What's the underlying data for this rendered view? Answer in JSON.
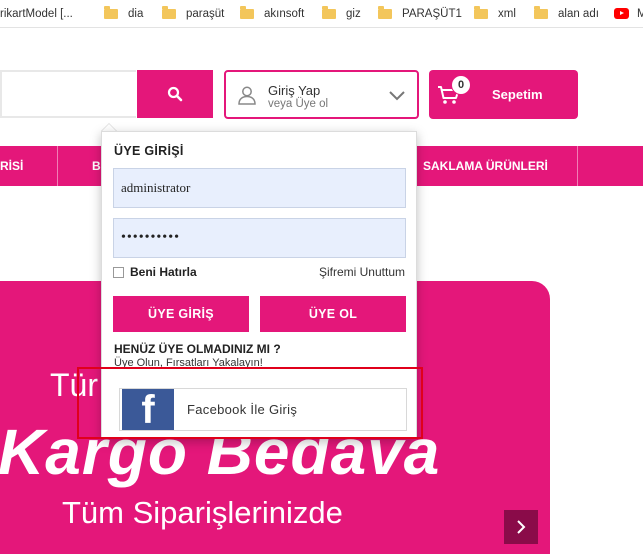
{
  "bookmarks": [
    {
      "label": "rikartModel [...",
      "icon": "none"
    },
    {
      "label": "dia",
      "icon": "folder-icon"
    },
    {
      "label": "paraşüt",
      "icon": "folder-icon"
    },
    {
      "label": "akınsoft",
      "icon": "folder-icon"
    },
    {
      "label": "giz",
      "icon": "folder-icon"
    },
    {
      "label": "PARAŞÜT1",
      "icon": "folder-icon"
    },
    {
      "label": "xml",
      "icon": "folder-icon"
    },
    {
      "label": "alan adı",
      "icon": "folder-icon"
    },
    {
      "label": "M",
      "icon": "youtube-icon"
    }
  ],
  "header": {
    "search_icon": "search-icon",
    "login_title": "Giriş Yap",
    "login_sub": "veya Üye ol",
    "cart_label": "Sepetim",
    "cart_count": "0"
  },
  "nav": {
    "items": [
      "RİSİ",
      "BI",
      "SAKLAMA ÜRÜNLERİ"
    ]
  },
  "hero": {
    "line1": "Tür",
    "line2": "Kargo Bedava",
    "line3": "Tüm Siparişlerinizde"
  },
  "login_panel": {
    "title": "ÜYE GİRİŞİ",
    "username_value": "administrator",
    "password_value": "••••••••••",
    "remember_label": "Beni Hatırla",
    "forgot_label": "Şifremi Unuttum",
    "login_button": "ÜYE GİRİŞ",
    "register_button": "ÜYE OL",
    "question_title": "HENÜZ ÜYE OLMADINIZ MI ?",
    "question_sub": "Üye Olun, Fırsatları Yakalayın!",
    "facebook_button": "Facebook İle Giriş"
  },
  "colors": {
    "brand": "#e4177a",
    "facebook": "#3b5998",
    "highlight": "#e0001b"
  }
}
